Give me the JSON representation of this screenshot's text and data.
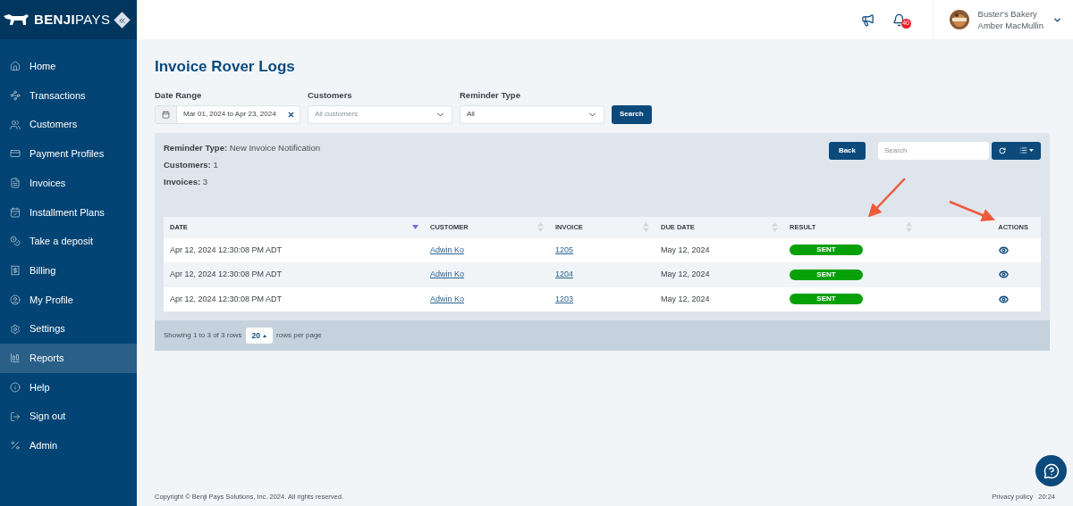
{
  "sidebar": {
    "logo": "**BENJI**PAYS",
    "items": [
      {
        "label": "Home",
        "selected": false
      },
      {
        "label": "Transactions",
        "selected": false
      },
      {
        "label": "Customers",
        "selected": false
      },
      {
        "label": "Payment Profiles",
        "selected": false
      },
      {
        "label": "Invoices",
        "selected": false
      },
      {
        "label": "Installment Plans",
        "selected": false
      },
      {
        "label": "Take a deposit",
        "selected": false
      },
      {
        "label": "Billing",
        "selected": false
      },
      {
        "label": "My Profile",
        "selected": false
      },
      {
        "label": "Settings",
        "selected": false
      },
      {
        "label": "Reports",
        "selected": true
      },
      {
        "label": "Help",
        "selected": false
      },
      {
        "label": "Sign out",
        "selected": false
      },
      {
        "label": "Admin",
        "selected": false
      }
    ]
  },
  "header": {
    "notification_count": "40",
    "business": "Buster's Bakery",
    "user": "Amber MacMullin"
  },
  "page_title": "Invoice Rover Logs",
  "filters": {
    "date_range": {
      "label": "Date Range",
      "value": "Mar 01, 2024 to Apr 23, 2024"
    },
    "customers": {
      "label": "Customers",
      "placeholder": "All customers"
    },
    "reminder_type": {
      "label": "Reminder Type",
      "value": "All"
    },
    "search_button": "Search"
  },
  "summary": [
    {
      "label": "Reminder Type:",
      "value": "New Invoice Notification"
    },
    {
      "label": "Customers:",
      "value": "1"
    },
    {
      "label": "Invoices:",
      "value": "3"
    }
  ],
  "toolbar": {
    "back_button": "Back",
    "search_placeholder": "Search"
  },
  "table": {
    "columns": [
      {
        "label": "DATE",
        "sortable": true,
        "sorted": true
      },
      {
        "label": "CUSTOMER",
        "sortable": true,
        "sorted": false
      },
      {
        "label": "INVOICE",
        "sortable": true,
        "sorted": false
      },
      {
        "label": "DUE DATE",
        "sortable": true,
        "sorted": false
      },
      {
        "label": "RESULT",
        "sortable": true,
        "sorted": false
      },
      {
        "label": "ACTIONS",
        "sortable": false,
        "sorted": false
      }
    ],
    "rows": [
      {
        "date": "Apr 12, 2024 12:30:08 PM ADT",
        "customer": "Adwin Ko",
        "invoice": "1205",
        "due_date": "May 12, 2024",
        "result": "SENT",
        "color": "#08a008"
      },
      {
        "date": "Apr 12, 2024 12:30:08 PM ADT",
        "customer": "Adwin Ko",
        "invoice": "1204",
        "due_date": "May 12, 2024",
        "result": "SENT",
        "color": "#08a008"
      },
      {
        "date": "Apr 12, 2024 12:30:08 PM ADT",
        "customer": "Adwin Ko",
        "invoice": "1203",
        "due_date": "May 12, 2024",
        "result": "SENT",
        "color": "#08a008"
      }
    ]
  },
  "pagination": {
    "showing": "Showing 1 to 3 of 3 rows",
    "page_size": "20",
    "suffix": "rows per page"
  },
  "footer": {
    "copyright": "Copyright © Benji Pays Solutions, Inc. 2024. All rights reserved.",
    "privacy": "Privacy policy",
    "time": "20:24"
  }
}
